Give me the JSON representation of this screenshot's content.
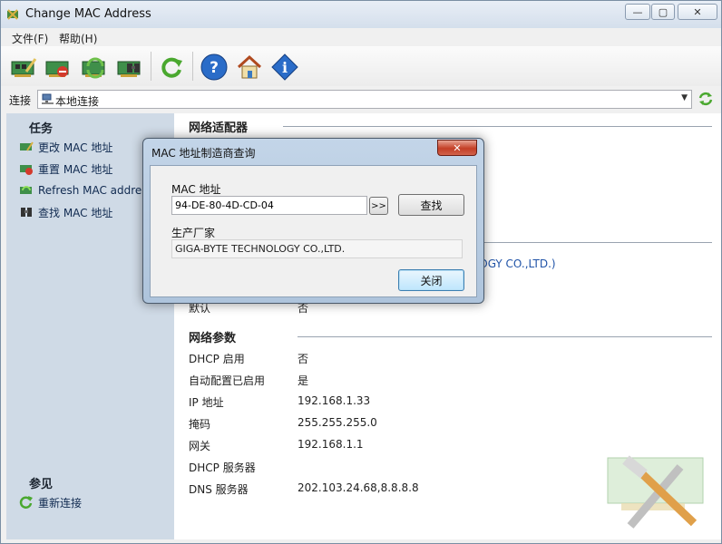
{
  "window": {
    "title": "Change MAC Address",
    "controls": {
      "minimize": "—",
      "maximize": "▢",
      "close": "✕"
    }
  },
  "menu": [
    {
      "label": "文件(F)"
    },
    {
      "label": "帮助(H)"
    }
  ],
  "toolbar": {
    "buttons": [
      {
        "icon": "change-mac-icon"
      },
      {
        "icon": "reset-mac-icon"
      },
      {
        "icon": "refresh-mac-icon"
      },
      {
        "icon": "find-mac-icon"
      },
      {
        "icon": "refresh-icon"
      },
      {
        "icon": "help-icon",
        "glyph": "?"
      },
      {
        "icon": "home-icon"
      },
      {
        "icon": "info-icon",
        "glyph": "i"
      }
    ]
  },
  "connection": {
    "label": "连接",
    "selected": "本地连接"
  },
  "tasks": {
    "heading": "任务",
    "items": [
      {
        "label": "更改 MAC 地址"
      },
      {
        "label": "重置 MAC 地址"
      },
      {
        "label": "Refresh MAC address"
      },
      {
        "label": "查找 MAC 地址"
      }
    ]
  },
  "see_also": {
    "heading": "参见",
    "items": [
      {
        "label": "重新连接"
      }
    ]
  },
  "details": {
    "adapter_heading": "网络适配器",
    "vendor_peek": "LOGY CO.,LTD.)",
    "default_label": "默认",
    "default_value": "否",
    "params_heading": "网络参数",
    "params": [
      {
        "label": "DHCP 启用",
        "value": "否"
      },
      {
        "label": "自动配置已启用",
        "value": "是"
      },
      {
        "label": "IP 地址",
        "value": "192.168.1.33"
      },
      {
        "label": "掩码",
        "value": "255.255.255.0"
      },
      {
        "label": "网关",
        "value": "192.168.1.1"
      },
      {
        "label": "DHCP 服务器",
        "value": ""
      },
      {
        "label": "DNS 服务器",
        "value": "202.103.24.68,8.8.8.8"
      }
    ]
  },
  "dialog": {
    "title": "MAC 地址制造商查询",
    "close_glyph": "✕",
    "mac_label": "MAC 地址",
    "mac_value": "94-DE-80-4D-CD-04",
    "more_label": ">>",
    "find_label": "查找",
    "vendor_label": "生产厂家",
    "vendor_value": "GIGA-BYTE TECHNOLOGY CO.,LTD.",
    "close_label": "关闭"
  },
  "colors": {
    "accent": "#2154a8",
    "left_pane": "#cfdae6",
    "dialog_frame": "#aec4dc",
    "close_red": "#c43f26"
  }
}
